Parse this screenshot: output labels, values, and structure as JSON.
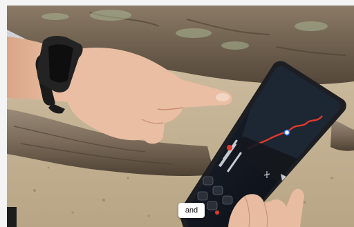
{
  "video": {
    "caption": "and"
  },
  "colors": {
    "page_bg": "#f4f4f4",
    "sand": "#b9a88f",
    "log": "#7d6d5d",
    "phone_body": "#1c1e22",
    "screen_dark": "#0e1118",
    "route_line": "#e0392b",
    "watch": "#1b1b1b",
    "skin": "#e6b79d"
  }
}
